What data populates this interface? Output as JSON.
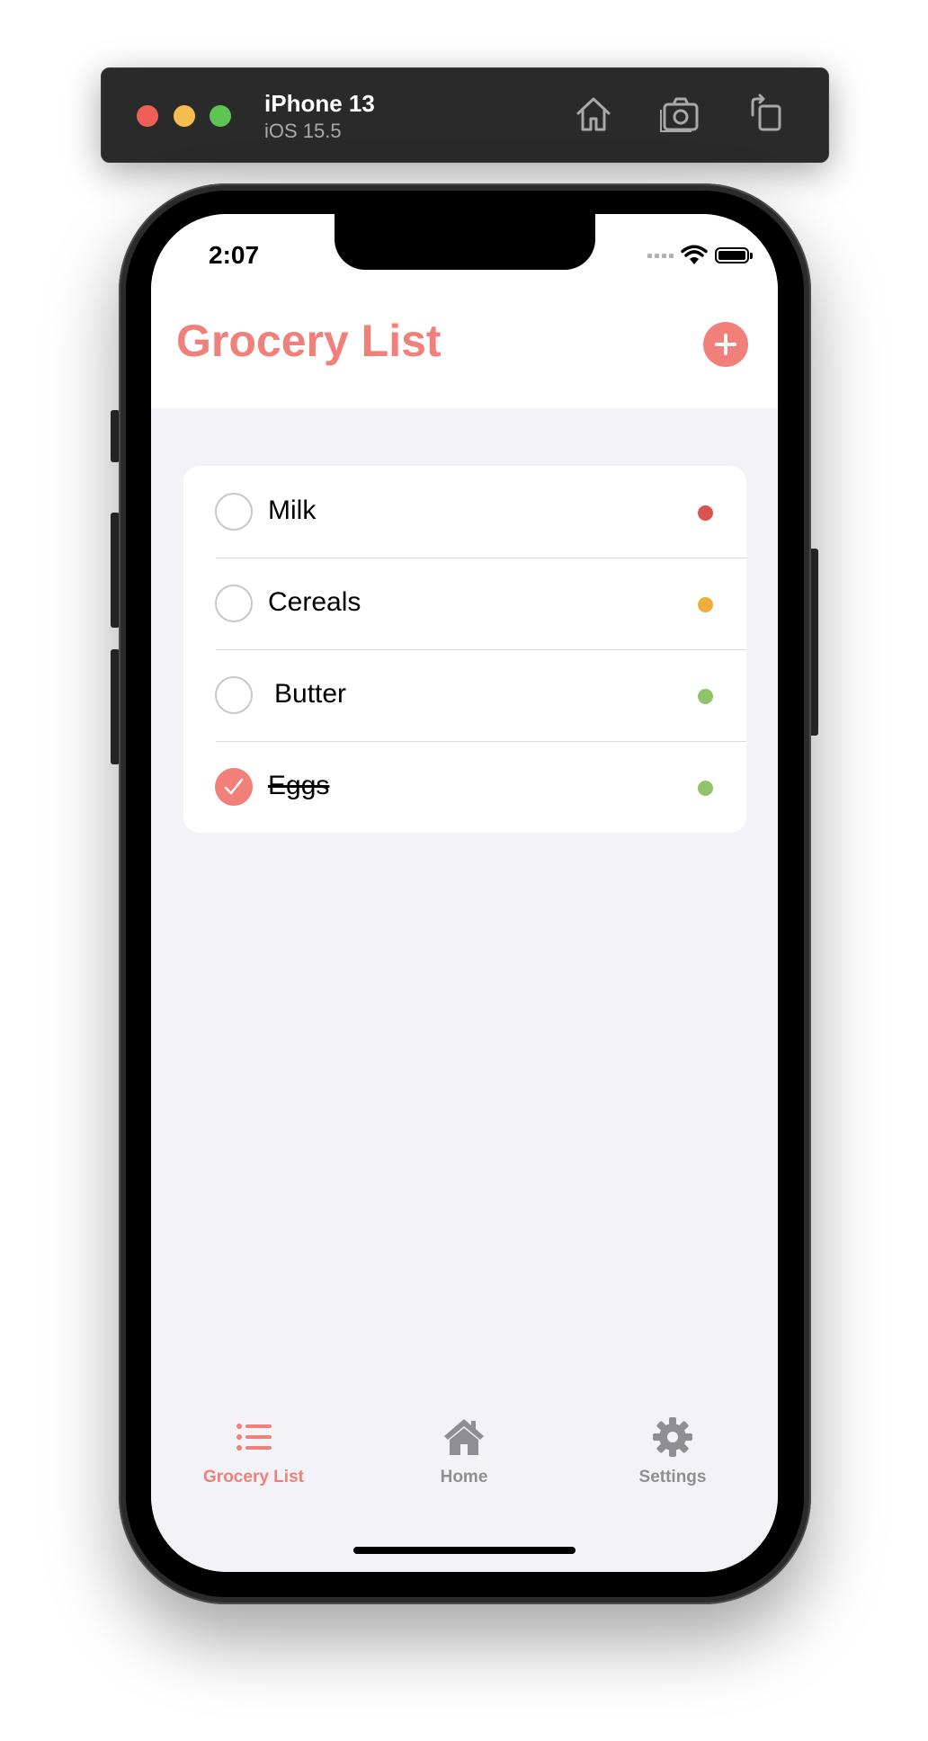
{
  "simulator": {
    "device_name": "iPhone 13",
    "os_version": "iOS 15.5",
    "toolbar_icons": [
      "home-icon",
      "screenshot-icon",
      "rotate-icon"
    ]
  },
  "status_bar": {
    "time": "2:07",
    "icons": [
      "cellular-icon",
      "wifi-icon",
      "battery-icon"
    ]
  },
  "header": {
    "title": "Grocery List",
    "add_icon": "plus-circle-icon"
  },
  "items": [
    {
      "label": "Milk",
      "checked": false,
      "priority_color": "#d9534f"
    },
    {
      "label": "Cereals",
      "checked": false,
      "priority_color": "#f0ad3c"
    },
    {
      "label": "Butter",
      "checked": false,
      "priority_color": "#8fc46a"
    },
    {
      "label": "Eggs",
      "checked": true,
      "priority_color": "#8fc46a"
    }
  ],
  "tabs": [
    {
      "label": "Grocery List",
      "icon": "list-icon",
      "selected": true
    },
    {
      "label": "Home",
      "icon": "house-icon",
      "selected": false
    },
    {
      "label": "Settings",
      "icon": "gear-icon",
      "selected": false
    }
  ],
  "colors": {
    "accent": "#f08079",
    "tab_inactive": "#8e8e93",
    "background": "#f2f2f7"
  }
}
